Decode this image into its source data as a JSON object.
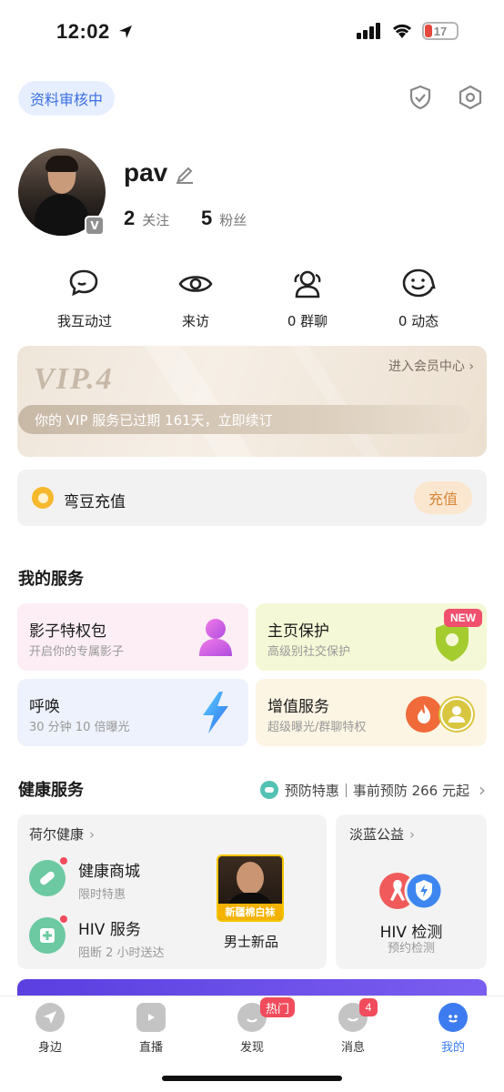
{
  "status_bar": {
    "time": "12:02",
    "battery": "17"
  },
  "header": {
    "review_badge": "资料审核中",
    "icons": [
      "shield-check-icon",
      "settings-hexagon-icon"
    ]
  },
  "profile": {
    "username": "pav",
    "verified_badge": "V",
    "following": {
      "count": "2",
      "label": "关注"
    },
    "followers": {
      "count": "5",
      "label": "粉丝"
    }
  },
  "quick_actions": [
    {
      "label": "我互动过",
      "icon": "chat-bubbles-icon"
    },
    {
      "label": "来访",
      "icon": "eye-icon"
    },
    {
      "label": "0 群聊",
      "icon": "group-icon"
    },
    {
      "label": "0 动态",
      "icon": "smile-face-icon"
    }
  ],
  "vip": {
    "title": "VIP.4",
    "center_link": "进入会员中心",
    "expired_msg": "你的 VIP 服务已过期 161天，立即续订"
  },
  "coins": {
    "label": "弯豆充值",
    "button": "充值"
  },
  "services": {
    "title": "我的服务",
    "items": [
      {
        "title": "影子特权包",
        "subtitle": "开启你的专属影子",
        "bg": "#fdeef5"
      },
      {
        "title": "主页保护",
        "subtitle": "高级别社交保护",
        "bg": "#f5f8d6",
        "badge": "NEW"
      },
      {
        "title": "呼唤",
        "subtitle": "30 分钟 10 倍曝光",
        "bg": "#eef2fd"
      },
      {
        "title": "增值服务",
        "subtitle": "超级曝光/群聊特权",
        "bg": "#fdf5e4"
      }
    ]
  },
  "health": {
    "title": "健康服务",
    "promo": "预防特惠｜事前预防 266 元起",
    "left_card": {
      "title": "荷尔健康",
      "items": [
        {
          "title": "健康商城",
          "subtitle": "限时特惠"
        },
        {
          "title": "HIV 服务",
          "subtitle": "阻断 2 小时送达"
        }
      ],
      "product": {
        "tag": "新疆棉白袜",
        "label": "男士新品"
      }
    },
    "right_card": {
      "title": "淡蓝公益",
      "item_title": "HIV 检测",
      "item_subtitle": "预约检测"
    }
  },
  "tabbar": [
    {
      "label": "身边"
    },
    {
      "label": "直播"
    },
    {
      "label": "发现",
      "badge": "热门"
    },
    {
      "label": "消息",
      "badge": "4"
    },
    {
      "label": "我的",
      "active": true
    }
  ]
}
